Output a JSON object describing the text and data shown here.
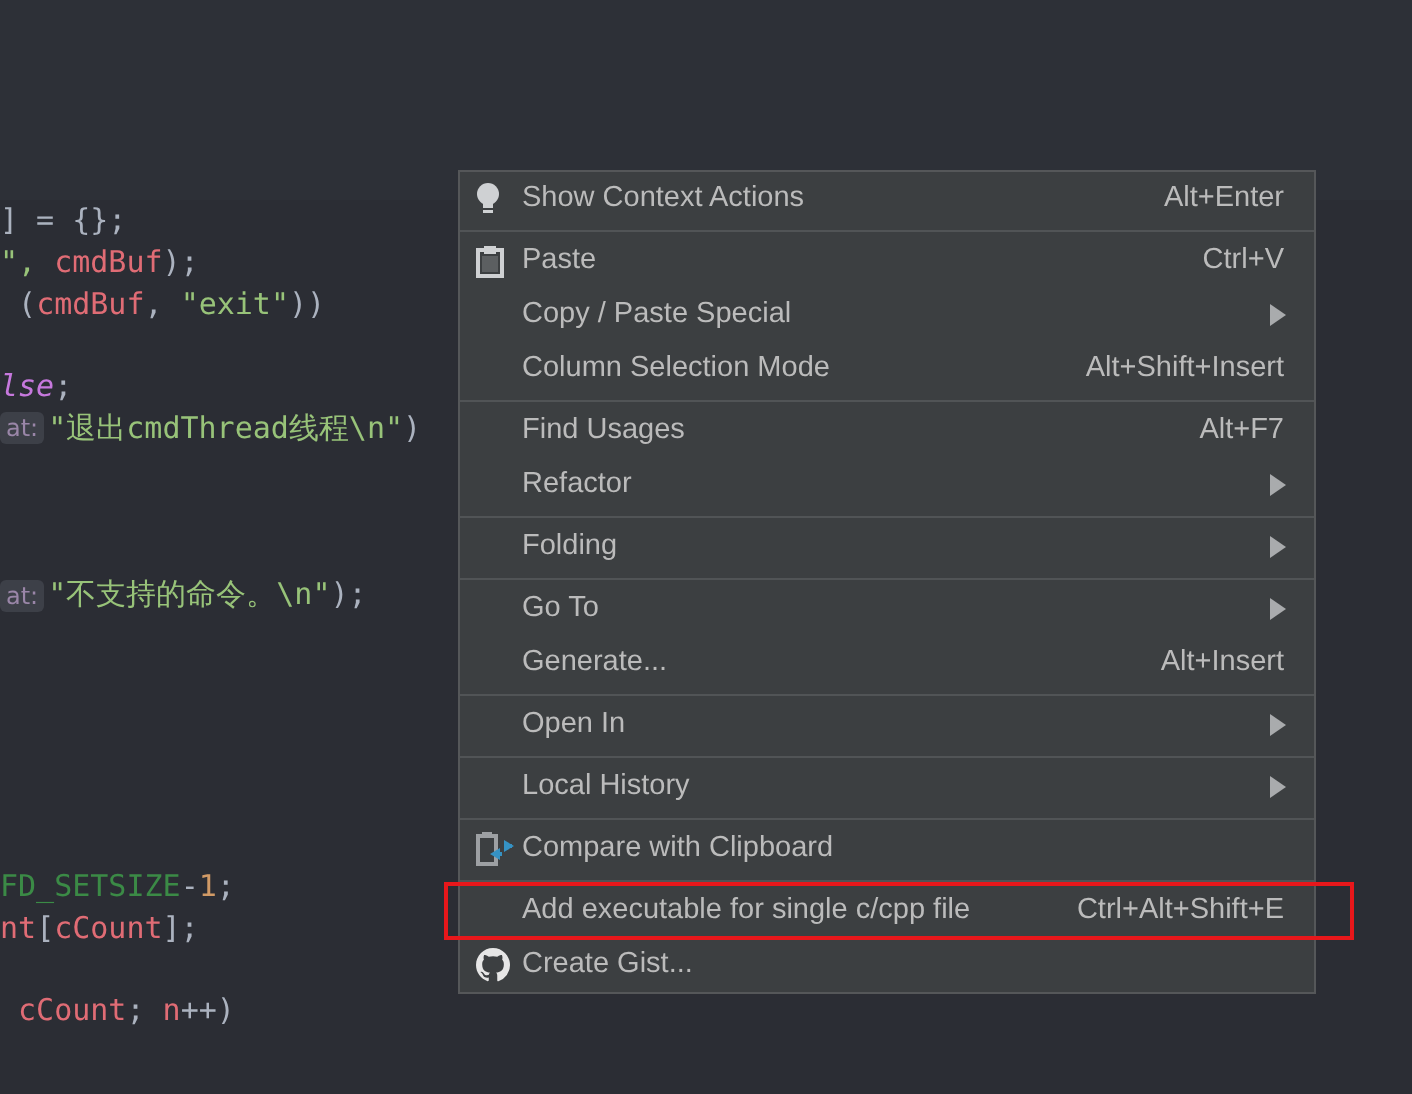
{
  "editor": {
    "lines": [
      {
        "segments": [
          {
            "text": "] = {};",
            "kind": "plain"
          }
        ]
      },
      {
        "segments": [
          {
            "text": "\", ",
            "kind": "string"
          },
          {
            "text": "cmdBuf",
            "kind": "var"
          },
          {
            "text": ");",
            "kind": "plain"
          }
        ]
      },
      {
        "segments": [
          {
            "text": " (",
            "kind": "plain"
          },
          {
            "text": "cmdBuf",
            "kind": "var"
          },
          {
            "text": ", ",
            "kind": "plain"
          },
          {
            "text": "\"exit\"",
            "kind": "string"
          },
          {
            "text": "))",
            "kind": "plain"
          }
        ]
      },
      {
        "segments": [
          {
            "text": "lse",
            "kind": "keyword"
          },
          {
            "text": ";",
            "kind": "plain"
          }
        ]
      },
      {
        "segments": [
          {
            "text": "at:",
            "kind": "hint"
          },
          {
            "text": "\"退出cmdThread线程\\n\"",
            "kind": "string"
          },
          {
            "text": ")",
            "kind": "plain"
          }
        ]
      },
      {
        "segments": [
          {
            "text": "at:",
            "kind": "hint"
          },
          {
            "text": "\"不支持的命令。\\n\"",
            "kind": "string"
          },
          {
            "text": ");",
            "kind": "plain"
          }
        ]
      },
      {
        "segments": [
          {
            "text": "FD_SETSIZE",
            "kind": "constant"
          },
          {
            "text": "-",
            "kind": "plain"
          },
          {
            "text": "1",
            "kind": "number"
          },
          {
            "text": ";",
            "kind": "plain"
          }
        ]
      },
      {
        "segments": [
          {
            "text": "nt",
            "kind": "var"
          },
          {
            "text": "[",
            "kind": "plain"
          },
          {
            "text": "cCount",
            "kind": "var"
          },
          {
            "text": "];",
            "kind": "plain"
          }
        ]
      },
      {
        "segments": [
          {
            "text": " cCount",
            "kind": "var"
          },
          {
            "text": "; ",
            "kind": "plain"
          },
          {
            "text": "n",
            "kind": "var"
          },
          {
            "text": "++)",
            "kind": "plain"
          }
        ]
      }
    ]
  },
  "context_menu": {
    "items": [
      {
        "kind": "item",
        "label": "Show Context Actions",
        "shortcut": "Alt+Enter",
        "submenu": false,
        "outlined": false
      },
      {
        "kind": "separator"
      },
      {
        "kind": "item",
        "label": "Paste",
        "shortcut": "Ctrl+V",
        "submenu": false,
        "outlined": false
      },
      {
        "kind": "item",
        "label": "Copy / Paste Special",
        "submenu": true,
        "outlined": false
      },
      {
        "kind": "item",
        "label": "Column Selection Mode",
        "shortcut": "Alt+Shift+Insert",
        "submenu": false,
        "outlined": false
      },
      {
        "kind": "separator"
      },
      {
        "kind": "item",
        "label": "Find Usages",
        "shortcut": "Alt+F7",
        "submenu": false,
        "outlined": false
      },
      {
        "kind": "item",
        "label": "Refactor",
        "submenu": true,
        "outlined": false
      },
      {
        "kind": "separator"
      },
      {
        "kind": "item",
        "label": "Folding",
        "submenu": true,
        "outlined": false
      },
      {
        "kind": "separator"
      },
      {
        "kind": "item",
        "label": "Go To",
        "submenu": true,
        "outlined": false
      },
      {
        "kind": "item",
        "label": "Generate...",
        "shortcut": "Alt+Insert",
        "submenu": false,
        "outlined": false
      },
      {
        "kind": "separator"
      },
      {
        "kind": "item",
        "label": "Open In",
        "submenu": true,
        "outlined": false
      },
      {
        "kind": "separator"
      },
      {
        "kind": "item",
        "label": "Local History",
        "submenu": true,
        "outlined": false
      },
      {
        "kind": "separator"
      },
      {
        "kind": "item",
        "label": "Compare with Clipboard",
        "submenu": false,
        "outlined": false
      },
      {
        "kind": "separator"
      },
      {
        "kind": "item",
        "label": "Add executable for single c/cpp file",
        "shortcut": "Ctrl+Alt+Shift+E",
        "submenu": false,
        "outlined": true
      },
      {
        "kind": "item",
        "label": "Create Gist...",
        "submenu": false,
        "outlined": false
      }
    ]
  }
}
